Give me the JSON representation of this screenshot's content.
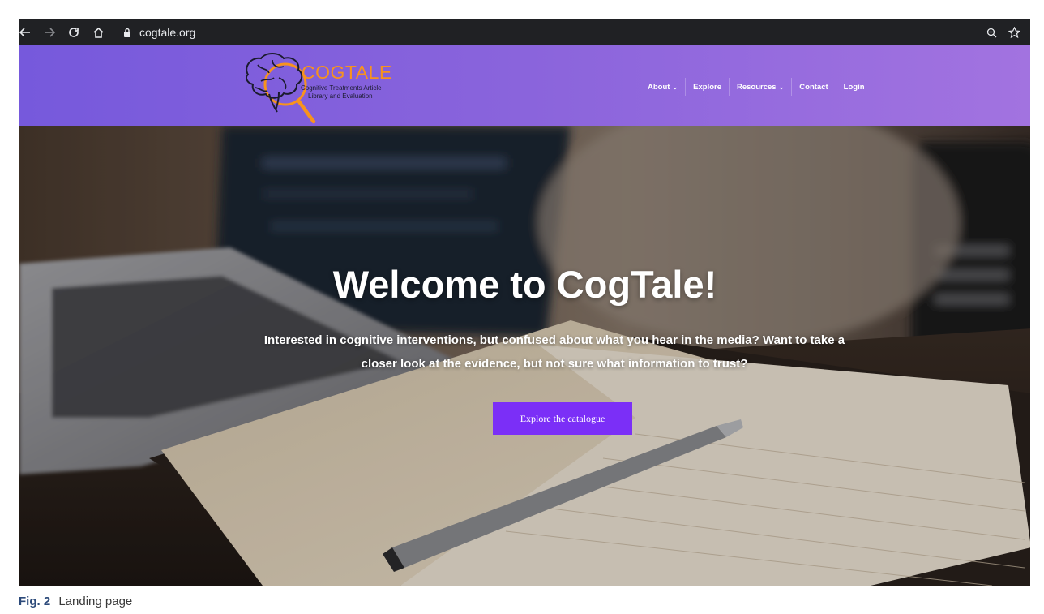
{
  "browser": {
    "url": "cogtale.org",
    "icons": [
      "back-arrow-icon",
      "forward-arrow-icon",
      "reload-icon",
      "home-icon",
      "lock-icon",
      "zoom-icon",
      "bookmark-star-icon"
    ]
  },
  "site": {
    "logo": {
      "title": "COGTALE",
      "subtitle_line1": "Cognitive Treatments Article",
      "subtitle_line2": "Library and Evaluation"
    },
    "nav": [
      {
        "label": "About",
        "dropdown": true
      },
      {
        "label": "Explore",
        "dropdown": false
      },
      {
        "label": "Resources",
        "dropdown": true
      },
      {
        "label": "Contact",
        "dropdown": false
      },
      {
        "label": "Login",
        "dropdown": false
      }
    ],
    "nav_chevron": "⌄"
  },
  "hero": {
    "title": "Welcome to CogTale!",
    "text": "Interested in cognitive interventions, but confused about what you hear in the media? Want to take a closer look at the evidence, but not sure what information to trust?",
    "cta_label": "Explore the catalogue"
  },
  "caption": {
    "label": "Fig. 2",
    "text": "Landing page"
  },
  "colors": {
    "header_gradient_start": "#7659dc",
    "header_gradient_end": "#a273e0",
    "logo_orange": "#f7931e",
    "cta_purple": "#7b2ff7",
    "browser_bar": "#202124"
  }
}
